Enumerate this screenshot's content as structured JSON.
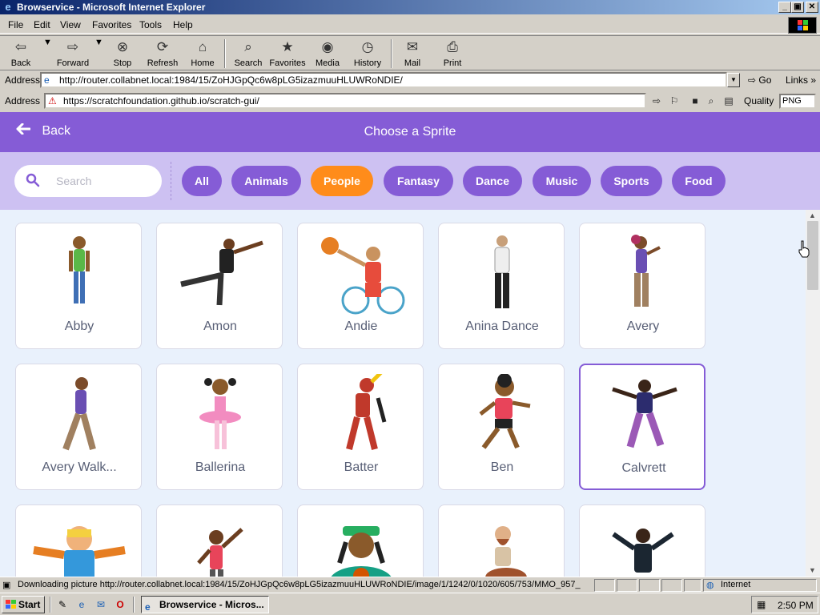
{
  "window": {
    "title": "Browservice - Microsoft Internet Explorer",
    "controls": [
      "_",
      "▣",
      "✕"
    ]
  },
  "menu": {
    "items": [
      {
        "label": "File"
      },
      {
        "label": "Edit"
      },
      {
        "label": "View"
      },
      {
        "label": "Favorites"
      },
      {
        "label": "Tools"
      },
      {
        "label": "Help"
      }
    ]
  },
  "toolbar": {
    "back": "Back",
    "forward": "Forward",
    "stop": "Stop",
    "refresh": "Refresh",
    "home": "Home",
    "search": "Search",
    "favorites": "Favorites",
    "media": "Media",
    "history": "History",
    "mail": "Mail",
    "print": "Print"
  },
  "address_bar": {
    "label": "Address",
    "url": "http://router.collabnet.local:1984/15/ZoHJGpQc6w8pLG5izazmuuHLUWRoNDIE/",
    "go": "Go",
    "links": "Links"
  },
  "inner_address_bar": {
    "label": "Address",
    "url": "https://scratchfoundation.github.io/scratch-gui/",
    "quality_label": "Quality",
    "quality_value": "PNG"
  },
  "scratch": {
    "back_label": "Back",
    "title": "Choose a Sprite",
    "search_placeholder": "Search",
    "categories": [
      {
        "label": "All",
        "active": false
      },
      {
        "label": "Animals",
        "active": false
      },
      {
        "label": "People",
        "active": true
      },
      {
        "label": "Fantasy",
        "active": false
      },
      {
        "label": "Dance",
        "active": false
      },
      {
        "label": "Music",
        "active": false
      },
      {
        "label": "Sports",
        "active": false
      },
      {
        "label": "Food",
        "active": false
      }
    ],
    "sprites": [
      {
        "name": "Abby"
      },
      {
        "name": "Amon"
      },
      {
        "name": "Andie"
      },
      {
        "name": "Anina Dance"
      },
      {
        "name": "Avery"
      },
      {
        "name": "Avery Walk..."
      },
      {
        "name": "Ballerina"
      },
      {
        "name": "Batter"
      },
      {
        "name": "Ben"
      },
      {
        "name": "Calvrett"
      },
      {
        "name": ""
      },
      {
        "name": ""
      },
      {
        "name": ""
      },
      {
        "name": ""
      },
      {
        "name": ""
      }
    ],
    "hovered_sprite": "Calvrett"
  },
  "status_bar": {
    "text": "Downloading picture http://router.collabnet.local:1984/15/ZoHJGpQc6w8pLG5izazmuuHLUWRoNDIE/image/1/1242/0/1020/605/753/MMO_957_",
    "zone": "Internet"
  },
  "taskbar": {
    "start": "Start",
    "task": "Browservice - Micros...",
    "clock": "2:50 PM"
  },
  "colors": {
    "scratch_purple": "#855cd6",
    "active_orange": "#ff8c1a",
    "filter_bg": "#cdc1f2",
    "grid_bg": "#e9f1fc"
  }
}
